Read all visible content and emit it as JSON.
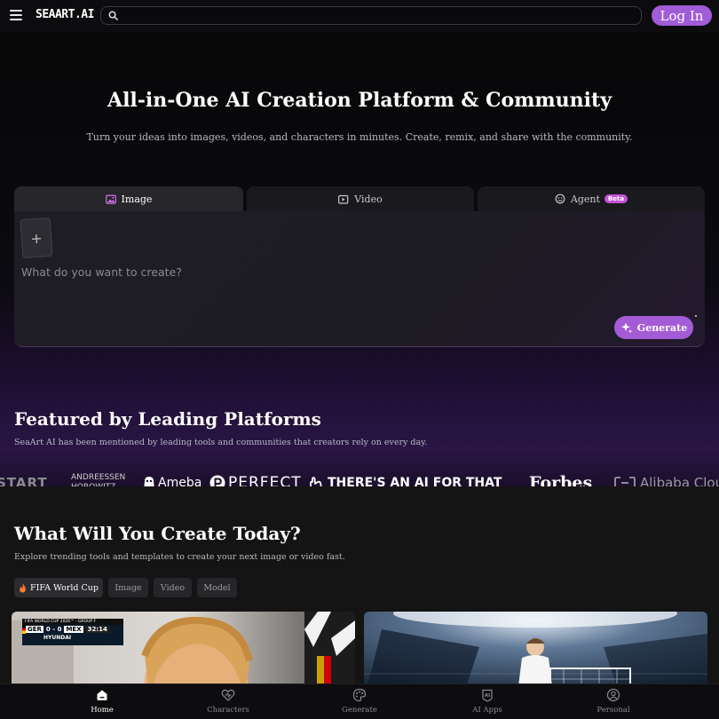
{
  "header": {
    "logo_text": "SEAART.AI",
    "search_placeholder": "",
    "login_label": "Log In"
  },
  "hero": {
    "title": "All-in-One AI Creation Platform & Community",
    "subtitle": "Turn your ideas into images, videos, and characters in minutes. Create, remix, and share with the community."
  },
  "tabs": {
    "image": "Image",
    "video": "Video",
    "agent": "Agent",
    "agent_badge": "Beta"
  },
  "prompt": {
    "placeholder": "What do you want to create?",
    "upload_symbol": "+",
    "generate_label": "Generate"
  },
  "featured": {
    "title": "Featured by Leading Platforms",
    "subtitle": "SeaArt AI has been mentioned by leading tools and communities that creators rely on every day.",
    "logos": [
      "START",
      "ANDREESSEN HOROWITZ",
      "Ameba",
      "PERFECT",
      "THERE'S AN AI FOR THAT",
      "Forbes",
      "Alibaba Cloud"
    ]
  },
  "create": {
    "title": "What Will You Create Today?",
    "subtitle": "Explore trending tools and templates to create your next image or video fast.",
    "chips": {
      "fifa": "FIFA World Cup",
      "image": "Image",
      "video": "Video",
      "model": "Model"
    },
    "scoreboard": {
      "event": "FIFA WORLD CUP 2026™ · GROUP F",
      "team_home": "GER",
      "score": "0 - 0",
      "team_away": "MEX",
      "clock": "32:14",
      "sponsor": "HYUNDAI"
    }
  },
  "bottom_nav": {
    "home": "Home",
    "characters": "Characters",
    "generate": "Generate",
    "ai_apps": "AI Apps",
    "personal": "Personal",
    "ai_apps_icon_text": "AI"
  },
  "colors": {
    "accent": "#a45bd6",
    "beta_badge": "#c553d6",
    "background": "#0a0a0d"
  }
}
